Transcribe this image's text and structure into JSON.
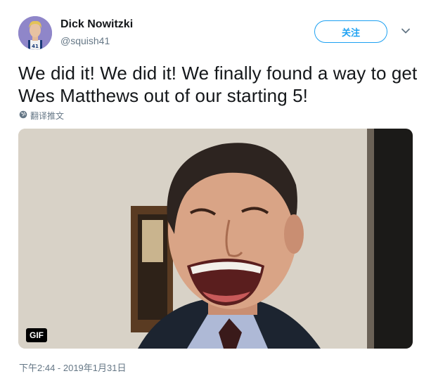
{
  "tweet": {
    "author_name": "Dick Nowitzki",
    "author_handle": "@squish41",
    "follow_label": "关注",
    "text": "We did it! We did it! We finally found a way to get Wes Matthews out of our starting 5!",
    "translate_label": "翻译推文",
    "media_badge": "GIF",
    "timestamp": "下午2:44 - 2019年1月31日"
  },
  "icons": {
    "caret": "chevron-down-icon",
    "translate": "globe-icon"
  },
  "colors": {
    "accent": "#1da1f2",
    "text_primary": "#14171a",
    "text_secondary": "#657786"
  }
}
